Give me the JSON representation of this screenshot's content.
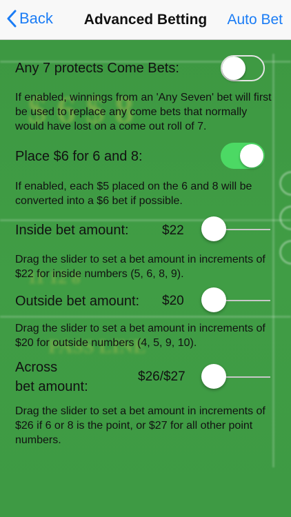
{
  "nav": {
    "back_label": "Back",
    "title": "Advanced Betting",
    "right_label": "Auto Bet"
  },
  "settings": {
    "any7": {
      "label": "Any 7 protects Come Bets:",
      "enabled": false,
      "description": "If enabled, winnings from an 'Any Seven' bet will first be used to replace any come bets that normally would have lost on a come out roll of 7."
    },
    "place6": {
      "label": "Place $6 for 6 and 8:",
      "enabled": true,
      "description": "If enabled, each $5 placed on the 6 and 8 will be converted into a $6 bet if possible."
    },
    "inside": {
      "label": "Inside bet amount:",
      "value": "$22",
      "slider_level": 0,
      "description": "Drag the slider to set a bet amount in increments of $22 for inside numbers (5, 6, 8, 9)."
    },
    "outside": {
      "label": "Outside bet amount:",
      "value": "$20",
      "slider_level": 0,
      "description": "Drag the slider to set a bet amount in increments of $20 for outside numbers (4, 5, 9, 10)."
    },
    "across": {
      "label_line1": "Across",
      "label_line2": "bet amount:",
      "value": "$26/$27",
      "slider_level": 0,
      "description": "Drag the slider to set a bet amount in increments of $26 if 6 or 8 is the point, or $27 for all other point numbers."
    }
  },
  "colors": {
    "accent": "#1a7cf5",
    "felt": "#3f9a43",
    "switch_on": "#4cd964"
  }
}
